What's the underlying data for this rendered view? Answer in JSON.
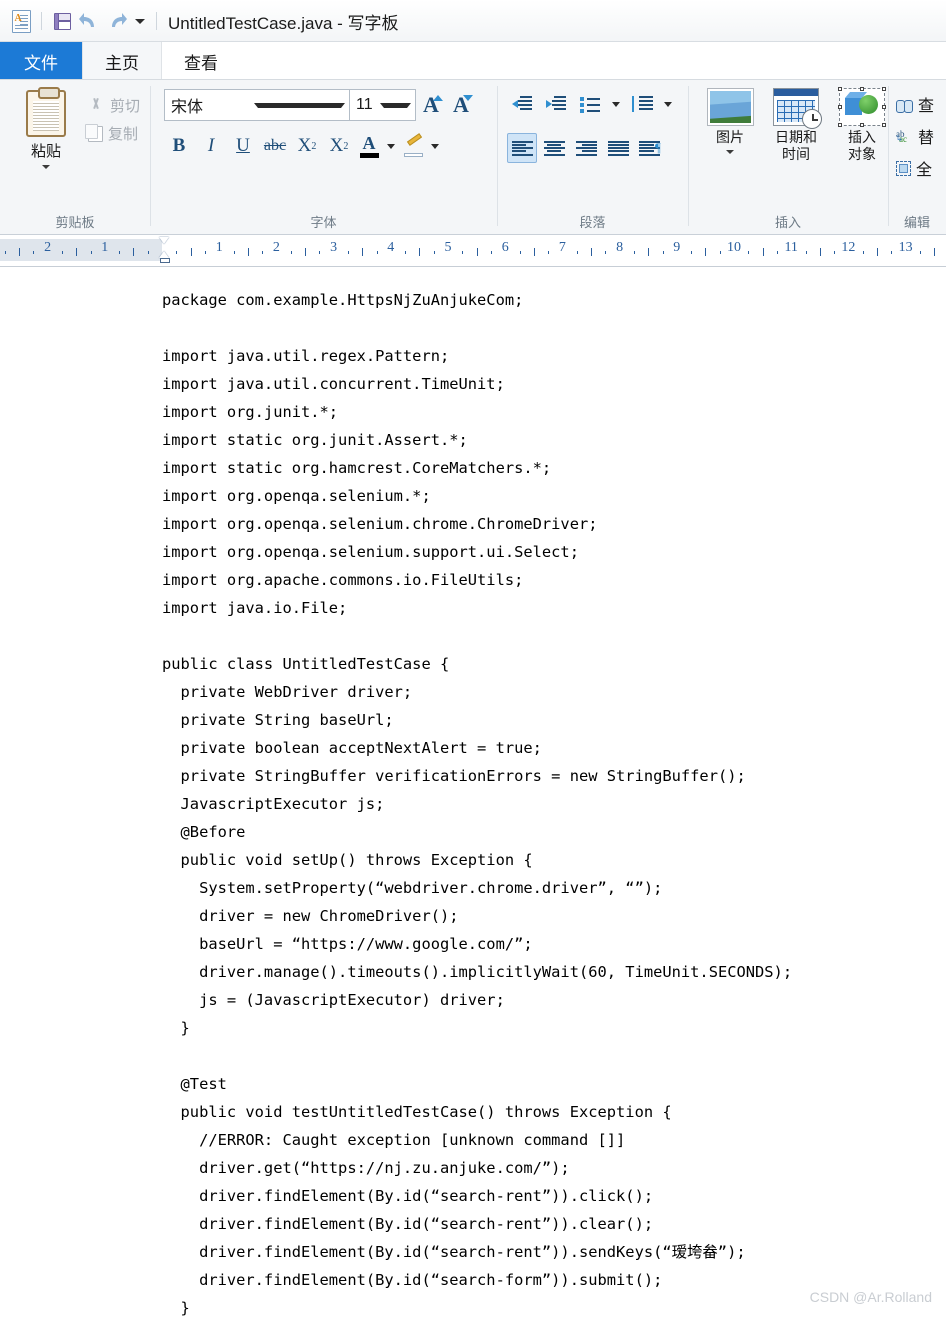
{
  "titlebar": {
    "app_icon": "wordpad-document-icon",
    "quick_access": [
      {
        "name": "save-icon",
        "label": "保存"
      },
      {
        "name": "undo-icon",
        "label": "撤销"
      },
      {
        "name": "redo-icon",
        "label": "恢复"
      },
      {
        "name": "customize-qat-icon",
        "label": "自定义快速访问工具栏"
      }
    ],
    "title": "UntitledTestCase.java - 写字板"
  },
  "tabs": [
    {
      "id": "file",
      "label": "文件",
      "state": "file"
    },
    {
      "id": "home",
      "label": "主页",
      "state": "active"
    },
    {
      "id": "view",
      "label": "查看",
      "state": "normal"
    }
  ],
  "ribbon": {
    "clipboard": {
      "label": "剪贴板",
      "paste": "粘贴",
      "cut": "剪切",
      "copy": "复制"
    },
    "font": {
      "label": "字体",
      "font_name": "宋体",
      "font_size": "11",
      "grow_font": "A",
      "shrink_font": "A",
      "bold": "B",
      "italic": "I",
      "underline": "U",
      "strikethrough": "abc",
      "subscript": "X",
      "subscript_index": "2",
      "superscript": "X",
      "superscript_index": "2",
      "text_color": "A",
      "text_color_value": "#000000",
      "highlight_color_value": "#ffffff"
    },
    "paragraph": {
      "label": "段落",
      "decrease_indent": "减少缩进量",
      "increase_indent": "增加缩进量",
      "bullets": "开始列表",
      "line_spacing": "行距",
      "align_left": "左对齐",
      "align_center": "居中",
      "align_right": "右对齐",
      "justify": "两端对齐",
      "paragraph_marks": "段落标记",
      "selected_alignment": "align_left"
    },
    "insert": {
      "label": "插入",
      "picture": "图片",
      "datetime_line1": "日期和",
      "datetime_line2": "时间",
      "object_line1": "插入",
      "object_line2": "对象"
    },
    "editing": {
      "label": "编辑",
      "find": "查",
      "replace": "替",
      "select_all": "全"
    }
  },
  "ruler": {
    "left_labels": [
      "2",
      "1"
    ],
    "right_labels": [
      "1",
      "2",
      "3",
      "4",
      "5",
      "6",
      "7",
      "8",
      "9",
      "10",
      "11",
      "12",
      "13"
    ],
    "indent_marker_position": "0"
  },
  "document": {
    "lines": [
      "package com.example.HttpsNjZuAnjukeCom;",
      "",
      "import java.util.regex.Pattern;",
      "import java.util.concurrent.TimeUnit;",
      "import org.junit.*;",
      "import static org.junit.Assert.*;",
      "import static org.hamcrest.CoreMatchers.*;",
      "import org.openqa.selenium.*;",
      "import org.openqa.selenium.chrome.ChromeDriver;",
      "import org.openqa.selenium.support.ui.Select;",
      "import org.apache.commons.io.FileUtils;",
      "import java.io.File;",
      "",
      "public class UntitledTestCase {",
      "  private WebDriver driver;",
      "  private String baseUrl;",
      "  private boolean acceptNextAlert = true;",
      "  private StringBuffer verificationErrors = new StringBuffer();",
      "  JavascriptExecutor js;",
      "  @Before",
      "  public void setUp() throws Exception {",
      "    System.setProperty(“webdriver.chrome.driver”, “”);",
      "    driver = new ChromeDriver();",
      "    baseUrl = “https://www.google.com/”;",
      "    driver.manage().timeouts().implicitlyWait(60, TimeUnit.SECONDS);",
      "    js = (JavascriptExecutor) driver;",
      "  }",
      "",
      "  @Test",
      "  public void testUntitledTestCase() throws Exception {",
      "    //ERROR: Caught exception [unknown command []]",
      "    driver.get(“https://nj.zu.anjuke.com/”);",
      "    driver.findElement(By.id(“search-rent”)).click();",
      "    driver.findElement(By.id(“search-rent”)).clear();",
      "    driver.findElement(By.id(“search-rent”)).sendKeys(“瑷垮畚”);",
      "    driver.findElement(By.id(“search-form”)).submit();",
      "  }"
    ]
  },
  "watermark": "CSDN @Ar.Rolland"
}
